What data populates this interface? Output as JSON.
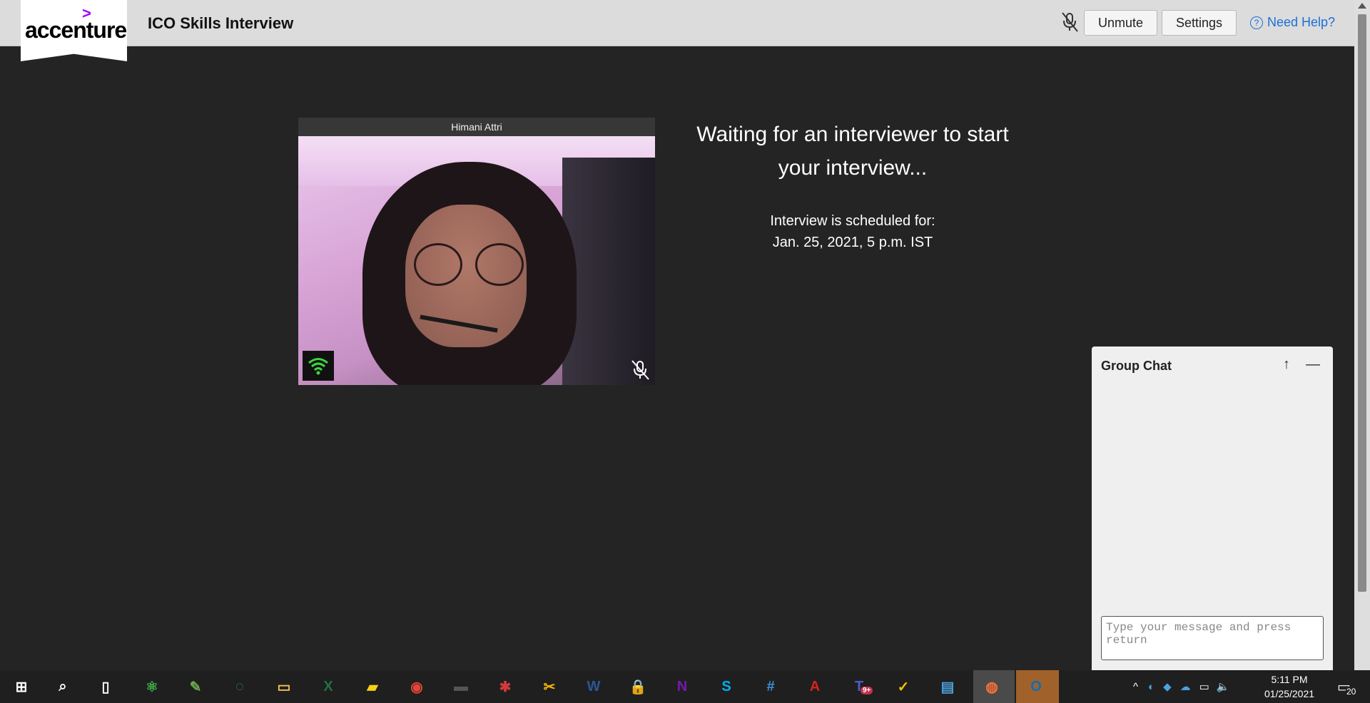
{
  "header": {
    "logo_text": "accenture",
    "title": "ICO Skills Interview",
    "unmute_label": "Unmute",
    "settings_label": "Settings",
    "help_label": "Need Help?",
    "help_icon_glyph": "?"
  },
  "video": {
    "participant_name": "Himani Attri",
    "network_icon": "wifi-icon",
    "mic_state_icon": "mic-off-icon"
  },
  "status": {
    "waiting_line1": "Waiting for an interviewer to start",
    "waiting_line2": "your interview...",
    "schedule_label": "Interview is scheduled for:",
    "schedule_value": "Jan. 25, 2021, 5 p.m. IST"
  },
  "chat": {
    "title": "Group Chat",
    "expand_glyph": "↑",
    "minimize_glyph": "—",
    "input_placeholder": "Type your message and press return"
  },
  "taskbar": {
    "apps": [
      {
        "name": "start",
        "glyph": "⊞",
        "color": "#ffffff"
      },
      {
        "name": "search",
        "glyph": "⌕",
        "color": "#ffffff"
      },
      {
        "name": "task-view",
        "glyph": "▯",
        "color": "#ffffff"
      },
      {
        "name": "atom",
        "glyph": "⚛",
        "color": "#3fae49"
      },
      {
        "name": "paint",
        "glyph": "✎",
        "color": "#6aa84f"
      },
      {
        "name": "loader",
        "glyph": "◌",
        "color": "#2e9e44"
      },
      {
        "name": "file-explorer",
        "glyph": "▭",
        "color": "#f2c14e"
      },
      {
        "name": "excel",
        "glyph": "X",
        "color": "#1f7244"
      },
      {
        "name": "sticky-notes",
        "glyph": "▰",
        "color": "#f7d117"
      },
      {
        "name": "chrome",
        "glyph": "◉",
        "color": "#e0453a"
      },
      {
        "name": "terminal",
        "glyph": "▬",
        "color": "#555555"
      },
      {
        "name": "web-app",
        "glyph": "✱",
        "color": "#d03a3a"
      },
      {
        "name": "snip",
        "glyph": "✂",
        "color": "#f2b705"
      },
      {
        "name": "word",
        "glyph": "W",
        "color": "#2b5797"
      },
      {
        "name": "lock-app",
        "glyph": "🔒",
        "color": "#bbbbbb"
      },
      {
        "name": "onenote",
        "glyph": "N",
        "color": "#7719aa"
      },
      {
        "name": "skype",
        "glyph": "S",
        "color": "#00aff0"
      },
      {
        "name": "snipping-grid",
        "glyph": "#",
        "color": "#3a8fd8"
      },
      {
        "name": "acrobat",
        "glyph": "A",
        "color": "#d9211f"
      },
      {
        "name": "teams",
        "glyph": "T",
        "color": "#5059c9"
      },
      {
        "name": "norton",
        "glyph": "✓",
        "color": "#f2c100"
      },
      {
        "name": "contacts",
        "glyph": "▤",
        "color": "#4a9fd8"
      },
      {
        "name": "firefox",
        "glyph": "◍",
        "color": "#ff7139"
      },
      {
        "name": "outlook",
        "glyph": "O",
        "color": "#0f6cbd"
      }
    ],
    "teams_badge": "9+",
    "clock_time": "5:11 PM",
    "clock_date": "01/25/2021",
    "notification_count": "20"
  },
  "colors": {
    "background": "#242424",
    "header": "#dcdcdc",
    "accent_purple": "#a100ff",
    "link_blue": "#1e6fd6",
    "wifi_green": "#3ed43e"
  }
}
